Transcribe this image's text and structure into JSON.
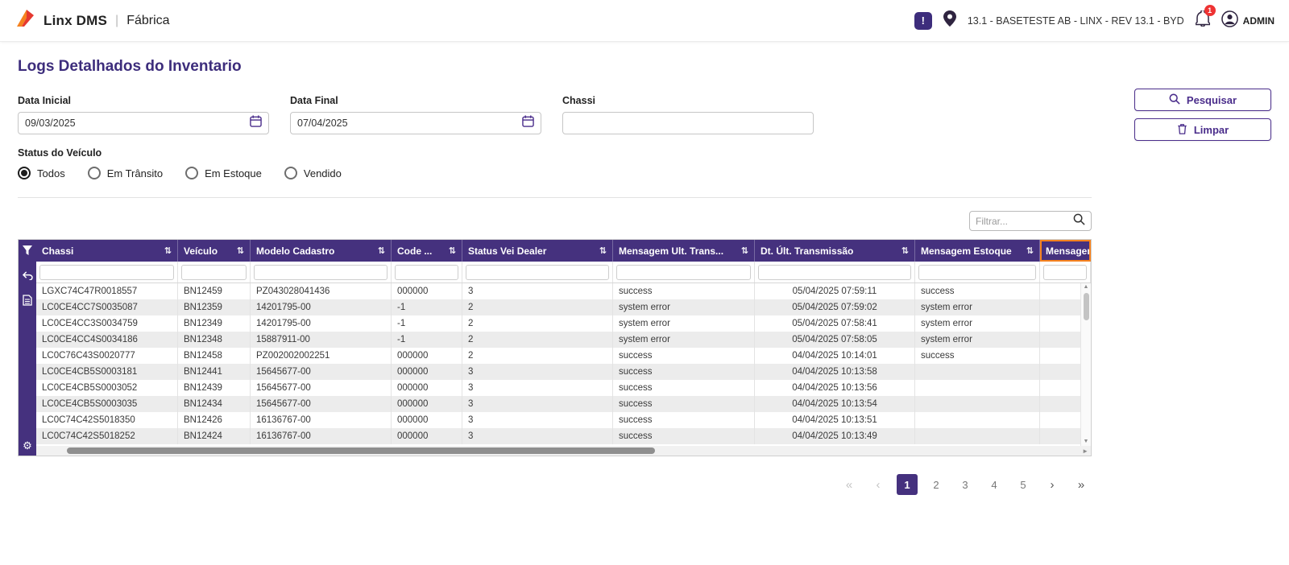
{
  "colors": {
    "primary_purple": "#45317e",
    "accent_purple": "#4a2d8b",
    "brand_orange": "#f5821f",
    "selection_orange": "#f5821f",
    "badge_red": "#ee3333",
    "row_alt_gray": "#ececec"
  },
  "icons": {
    "sort": "⇅",
    "gear": "⚙",
    "feedback_glyph": "!",
    "scroll_up": "▲",
    "scroll_down": "▼",
    "scroll_right": "►"
  },
  "topbar": {
    "brand": "Linx DMS",
    "separator": "|",
    "module": "Fábrica",
    "environment": "13.1 - BASETESTE AB - LINX - REV 13.1 - BYD",
    "notification_badge": "1",
    "user_label": "ADMIN"
  },
  "page": {
    "title": "Logs Detalhados do Inventario"
  },
  "filters": {
    "data_inicial_label": "Data Inicial",
    "data_inicial_value": "09/03/2025",
    "data_final_label": "Data Final",
    "data_final_value": "07/04/2025",
    "chassi_label": "Chassi",
    "chassi_value": "",
    "status_label": "Status do Veículo",
    "status_options": [
      {
        "label": "Todos",
        "selected": true
      },
      {
        "label": "Em Trânsito",
        "selected": false
      },
      {
        "label": "Em Estoque",
        "selected": false
      },
      {
        "label": "Vendido",
        "selected": false
      }
    ],
    "search_button": "Pesquisar",
    "clear_button": "Limpar"
  },
  "table": {
    "quick_filter_placeholder": "Filtrar...",
    "columns": [
      {
        "key": "chassi",
        "label": "Chassi",
        "sortable": true
      },
      {
        "key": "veiculo",
        "label": "Veículo",
        "sortable": true
      },
      {
        "key": "modelo-cadastro",
        "label": "Modelo Cadastro",
        "sortable": true
      },
      {
        "key": "code",
        "label": "Code ...",
        "sortable": true
      },
      {
        "key": "status-vei-dealer",
        "label": "Status Vei Dealer",
        "sortable": true
      },
      {
        "key": "mensagem-ult-trans",
        "label": "Mensagem Ult. Trans...",
        "sortable": true
      },
      {
        "key": "dt-ult-transmissao",
        "label": "Dt. Últ. Transmissão",
        "sortable": true
      },
      {
        "key": "mensagem-estoque",
        "label": "Mensagem Estoque",
        "sortable": true
      },
      {
        "key": "mensagem",
        "label": "Mensagem",
        "sortable": false,
        "selected": true
      }
    ],
    "rows": [
      [
        "LGXC74C47R0018557",
        "BN12459",
        "PZ043028041436",
        "000000",
        "3",
        "success",
        "05/04/2025 07:59:11",
        "success",
        ""
      ],
      [
        "LC0CE4CC7S0035087",
        "BN12359",
        "14201795-00",
        "-1",
        "2",
        "system error",
        "05/04/2025 07:59:02",
        "system error",
        ""
      ],
      [
        "LC0CE4CC3S0034759",
        "BN12349",
        "14201795-00",
        "-1",
        "2",
        "system error",
        "05/04/2025 07:58:41",
        "system error",
        ""
      ],
      [
        "LC0CE4CC4S0034186",
        "BN12348",
        "15887911-00",
        "-1",
        "2",
        "system error",
        "05/04/2025 07:58:05",
        "system error",
        ""
      ],
      [
        "LC0C76C43S0020777",
        "BN12458",
        "PZ002002002251",
        "000000",
        "2",
        "success",
        "04/04/2025 10:14:01",
        "success",
        ""
      ],
      [
        "LC0CE4CB5S0003181",
        "BN12441",
        "15645677-00",
        "000000",
        "3",
        "success",
        "04/04/2025 10:13:58",
        "",
        ""
      ],
      [
        "LC0CE4CB5S0003052",
        "BN12439",
        "15645677-00",
        "000000",
        "3",
        "success",
        "04/04/2025 10:13:56",
        "",
        ""
      ],
      [
        "LC0CE4CB5S0003035",
        "BN12434",
        "15645677-00",
        "000000",
        "3",
        "success",
        "04/04/2025 10:13:54",
        "",
        ""
      ],
      [
        "LC0C74C42S5018350",
        "BN12426",
        "16136767-00",
        "000000",
        "3",
        "success",
        "04/04/2025 10:13:51",
        "",
        ""
      ],
      [
        "LC0C74C42S5018252",
        "BN12424",
        "16136767-00",
        "000000",
        "3",
        "success",
        "04/04/2025 10:13:49",
        "",
        ""
      ]
    ]
  },
  "pagination": {
    "first": "«",
    "prev": "‹",
    "next": "›",
    "last": "»",
    "pages": [
      "1",
      "2",
      "3",
      "4",
      "5"
    ],
    "active_page": "1"
  }
}
